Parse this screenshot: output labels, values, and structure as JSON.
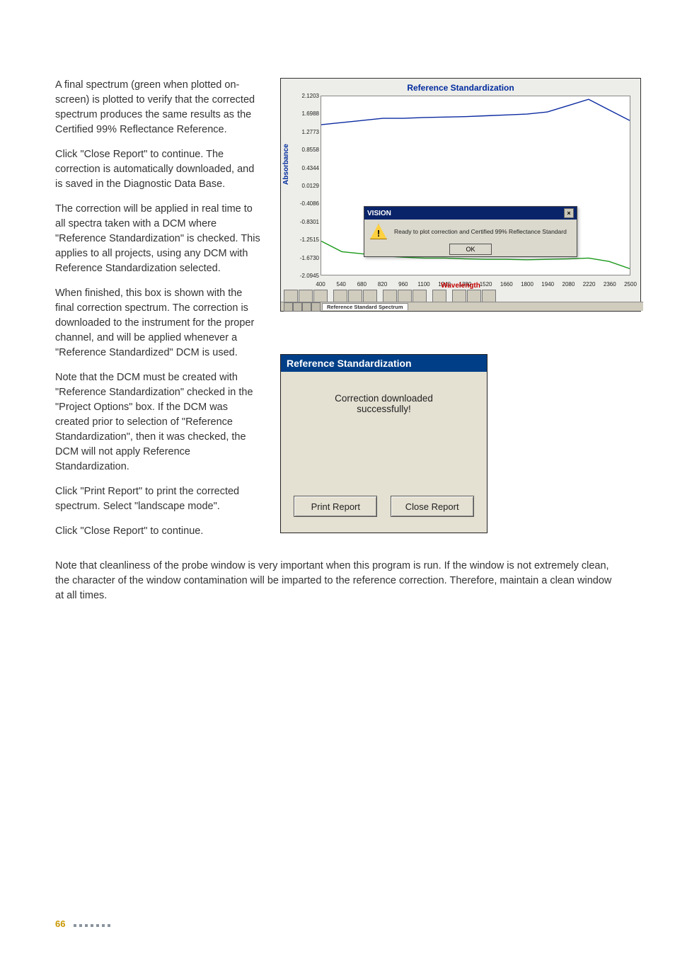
{
  "page_number": "66",
  "left_column": {
    "p1": "A final spectrum (green when plotted on-screen) is plotted to verify that the corrected spectrum produces the same results as the Certified 99% Reflectance Reference.",
    "p2": "Click \"Close Report\" to continue. The correction is automatically downloaded, and is saved in the Diagnostic Data Base.",
    "p3": "The correction will be applied in real time to all spectra taken with a DCM where \"Reference Standardization\" is checked. This applies to all projects, using any DCM with Reference Standardization selected.",
    "p4": "When finished, this box is shown with the final correction spectrum. The correction is downloaded to the instrument for the proper channel, and will be applied whenever a \"Reference Standardized\" DCM is used.",
    "p5": "Note that the DCM must be created with \"Reference Standardization\" checked in the \"Project Options\" box. If the DCM was created prior to selection of \"Reference Standardization\", then it was checked, the DCM will not apply Reference Standardization.",
    "p6": "Click \"Print Report\" to print the corrected spectrum. Select \"landscape mode\".",
    "p7": "Click \"Close Report\" to continue."
  },
  "bottom_paragraph": "Note that cleanliness of the probe window is very important when this program is run. If the window is not extremely clean, the character of the window contamination will be imparted to the reference correction. Therefore, maintain a clean window at all times.",
  "screenshot1": {
    "title": "Reference Standardization",
    "ylabel": "Absorbance",
    "xlabel": "Wavelength",
    "yticks": [
      "2.1203",
      "1.6988",
      "1.2773",
      "0.8558",
      "0.4344",
      "0.0129",
      "-0.4086",
      "-0.8301",
      "-1.2515",
      "-1.6730",
      "-2.0945"
    ],
    "xticks": [
      "400",
      "540",
      "680",
      "820",
      "960",
      "1100",
      "1240",
      "1380",
      "1520",
      "1660",
      "1800",
      "1940",
      "2080",
      "2220",
      "2360",
      "2500"
    ],
    "vision_dialog": {
      "title": "VISION",
      "msg": "Ready to plot correction and Certified 99% Reflectance Standard",
      "ok": "OK"
    },
    "tab_label": "Reference Standard Spectrum"
  },
  "screenshot2": {
    "title": "Reference Standardization",
    "msg_line1": "Correction downloaded",
    "msg_line2": "successfully!",
    "print_btn": "Print Report",
    "close_btn": "Close Report"
  },
  "chart_data": {
    "type": "line",
    "title": "Reference Standardization",
    "xlabel": "Wavelength",
    "ylabel": "Absorbance",
    "xlim": [
      400,
      2500
    ],
    "ylim": [
      -2.0945,
      2.1203
    ],
    "x": [
      400,
      540,
      680,
      820,
      960,
      1100,
      1240,
      1380,
      1520,
      1660,
      1800,
      1940,
      2080,
      2220,
      2360,
      2500
    ],
    "series": [
      {
        "name": "blue-curve",
        "color": "#0b2aa0",
        "values": [
          1.45,
          1.5,
          1.55,
          1.6,
          1.6,
          1.62,
          1.63,
          1.64,
          1.66,
          1.68,
          1.7,
          1.75,
          1.9,
          2.05,
          1.8,
          1.55
        ]
      },
      {
        "name": "green-curve",
        "color": "#1a991a",
        "values": [
          -1.3,
          -1.55,
          -1.6,
          -1.65,
          -1.68,
          -1.7,
          -1.7,
          -1.72,
          -1.73,
          -1.73,
          -1.74,
          -1.73,
          -1.72,
          -1.7,
          -1.78,
          -1.95
        ]
      }
    ]
  }
}
